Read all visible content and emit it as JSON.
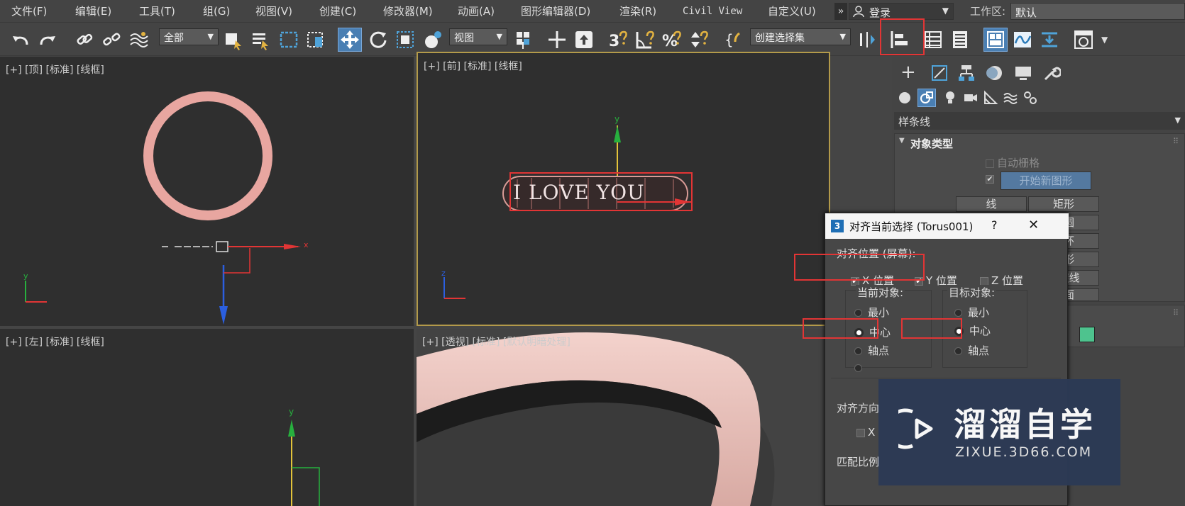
{
  "menu": [
    "文件(F)",
    "编辑(E)",
    "工具(T)",
    "组(G)",
    "视图(V)",
    "创建(C)",
    "修改器(M)",
    "动画(A)",
    "图形编辑器(D)",
    "渲染(R)",
    "Civil View",
    "自定义(U)"
  ],
  "overflow_glyph": "»",
  "login": "登录",
  "workspace_label": "工作区:",
  "workspace_value": "默认",
  "toolbar": {
    "filter": "全部",
    "ref_coord": "视图",
    "selection_set": "创建选择集"
  },
  "viewports": {
    "top": "[+] [顶] [标准] [线框]",
    "front": "[+] [前] [标准] [线框]",
    "left": "[+] [左] [标准] [线框]",
    "persp": "[+] [透视] [标准] [默认明暗处理]"
  },
  "text_object": "I LOVE YOU",
  "axis_labels": {
    "x": "x",
    "y": "y",
    "z": "z"
  },
  "cmd_panel": {
    "category": "样条线",
    "rollout_title": "对象类型",
    "auto_grid": "自动栅格",
    "start_new_shape": "开始新图形",
    "buttons_visible": [
      "线",
      "矩形",
      "椭圆",
      "圆环",
      "星形",
      "螺旋线",
      "截面"
    ]
  },
  "dialog": {
    "icon_text": "3",
    "title": "对齐当前选择 (Torus001)",
    "help": "?",
    "close": "✕",
    "align_position_label": "对齐位置 (屏幕):",
    "x_position": "X 位置",
    "y_position": "Y 位置",
    "z_position": "Z 位置",
    "current_object": "当前对象:",
    "target_object": "目标对象:",
    "options": [
      "最小",
      "中心",
      "轴点"
    ],
    "current_selected": "中心",
    "target_selected": "中心",
    "align_orientation": "对齐方向",
    "orientation_x": "X",
    "match_scale": "匹配比例"
  },
  "watermark": {
    "brand": "溜溜自学",
    "url": "ZIXUE.3D66.COM"
  },
  "colors": {
    "accent_red": "#e23535",
    "ring_pink": "#e8a6a0",
    "viewport_bg": "#2f2f2f",
    "active_border": "#b39a4a",
    "swatch_green": "#4ec38e"
  }
}
